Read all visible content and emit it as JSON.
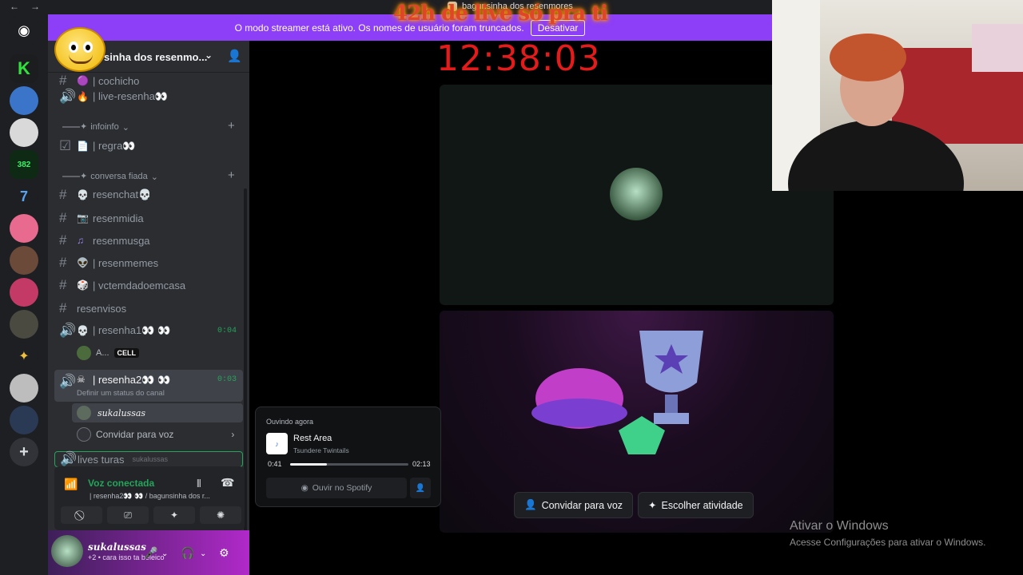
{
  "titlebar": {
    "title": "bagunsinha dos resenmores"
  },
  "overlay": {
    "live_text": "42h de live só pra ti",
    "clock": "12:38:03"
  },
  "banner": {
    "text": "O modo streamer está ativo. Os nomes de usuário foram truncados.",
    "button": "Desativar"
  },
  "server": {
    "name": "sinha dos resenmo..."
  },
  "channels": {
    "cochicho": "| cochicho",
    "live_resenha": "| live-resenha👀",
    "cat_infoinfo": "infoinfo",
    "regra": "| regra👀",
    "cat_conversa": "conversa fiada",
    "resenchat": "resenchat💀",
    "resenmidia": "resenmidia",
    "resenmusga": "resenmusga",
    "resenmemes": "| resenmemes",
    "vctemdado": "| vctemdadoemcasa",
    "resenvisos": "resenvisos",
    "resenha1": "| resenha1👀 👀",
    "resenha1_time": "0:04",
    "resenha1_user": "A...",
    "resenha1_badge": "CELL",
    "resenha2": "| resenha2👀 👀",
    "resenha2_time": "0:03",
    "resenha2_status": "Definir um status do canal",
    "resenha2_user": "sukalussas",
    "invite_voice": "Convidar para voz",
    "lives_turas": "lives turas",
    "lives_turas_user": "sukalussas"
  },
  "voice": {
    "status": "Voz conectada",
    "sub": "| resenha2👀 👀 / bagunsinha dos r..."
  },
  "user": {
    "name": "sukalussas",
    "status": "+2 • cara isso ta beleico"
  },
  "now_playing": {
    "header": "Ouvindo agora",
    "song": "Rest Area",
    "artist": "Tsundere Twintails",
    "elapsed": "0:41",
    "total": "02:13",
    "progress": 0.31,
    "spotify_btn": "Ouvir no Spotify"
  },
  "actions": {
    "invite": "Convidar para voz",
    "activity": "Escolher atividade"
  },
  "windows": {
    "title": "Ativar o Windows",
    "sub": "Acesse Configurações para ativar o Windows."
  },
  "colors": {
    "accent": "#8c3ff7",
    "online": "#23a55a",
    "clock": "#e31b1b"
  }
}
